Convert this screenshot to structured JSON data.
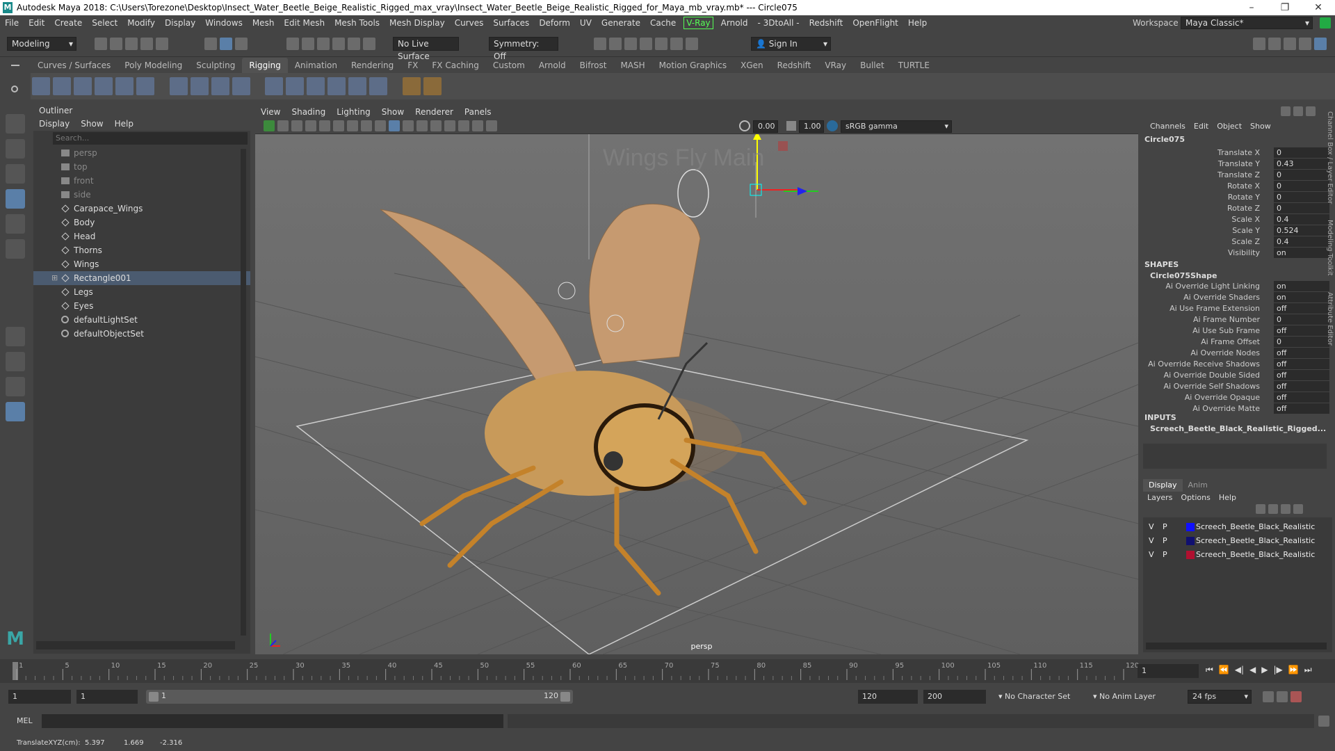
{
  "window": {
    "logo": "M",
    "title": "Autodesk Maya 2018: C:\\Users\\Torezone\\Desktop\\Insect_Water_Beetle_Beige_Realistic_Rigged_max_vray\\Insect_Water_Beetle_Beige_Realistic_Rigged_for_Maya_mb_vray.mb*  ---  Circle075",
    "controls": [
      "–",
      "❐",
      "✕"
    ]
  },
  "menubar": [
    "File",
    "Edit",
    "Create",
    "Select",
    "Modify",
    "Display",
    "Windows",
    "Mesh",
    "Edit Mesh",
    "Mesh Tools",
    "Mesh Display",
    "Curves",
    "Surfaces",
    "Deform",
    "UV",
    "Generate",
    "Cache",
    "V-Ray",
    "Arnold",
    "- 3DtoAll -",
    "Redshift",
    "OpenFlight",
    "Help"
  ],
  "workspace": {
    "label": "Workspace :",
    "value": "Maya Classic*"
  },
  "statusline": {
    "mode": "Modeling",
    "live_surface": "No Live Surface",
    "symmetry": "Symmetry: Off",
    "sign_in": "Sign In"
  },
  "shelf_tabs": [
    "Curves / Surfaces",
    "Poly Modeling",
    "Sculpting",
    "Rigging",
    "Animation",
    "Rendering",
    "FX",
    "FX Caching",
    "Custom",
    "Arnold",
    "Bifrost",
    "MASH",
    "Motion Graphics",
    "XGen",
    "Redshift",
    "VRay",
    "Bullet",
    "TURTLE"
  ],
  "shelf_active": "Rigging",
  "outliner": {
    "title": "Outliner",
    "menu": [
      "Display",
      "Show",
      "Help"
    ],
    "search_placeholder": "Search...",
    "items": [
      {
        "label": "persp",
        "kind": "camera"
      },
      {
        "label": "top",
        "kind": "camera"
      },
      {
        "label": "front",
        "kind": "camera"
      },
      {
        "label": "side",
        "kind": "camera"
      },
      {
        "label": "Carapace_Wings",
        "kind": "mesh"
      },
      {
        "label": "Body",
        "kind": "mesh"
      },
      {
        "label": "Head",
        "kind": "mesh"
      },
      {
        "label": "Thorns",
        "kind": "mesh"
      },
      {
        "label": "Wings",
        "kind": "mesh"
      },
      {
        "label": "Rectangle001",
        "kind": "mesh",
        "selected": true,
        "expandable": true
      },
      {
        "label": "Legs",
        "kind": "mesh"
      },
      {
        "label": "Eyes",
        "kind": "mesh"
      },
      {
        "label": "defaultLightSet",
        "kind": "set"
      },
      {
        "label": "defaultObjectSet",
        "kind": "set"
      }
    ]
  },
  "viewport": {
    "menu": [
      "View",
      "Shading",
      "Lighting",
      "Show",
      "Renderer",
      "Panels"
    ],
    "exposure": "0.00",
    "gamma": "1.00",
    "color_space": "sRGB gamma",
    "camera_label": "persp",
    "scene_text": "Wings  Fly  Main"
  },
  "channelbox": {
    "menu": [
      "Channels",
      "Edit",
      "Object",
      "Show"
    ],
    "object": "Circle075",
    "attrs": [
      {
        "k": "Translate X",
        "v": "0"
      },
      {
        "k": "Translate Y",
        "v": "0.43"
      },
      {
        "k": "Translate Z",
        "v": "0"
      },
      {
        "k": "Rotate X",
        "v": "0"
      },
      {
        "k": "Rotate Y",
        "v": "0"
      },
      {
        "k": "Rotate Z",
        "v": "0"
      },
      {
        "k": "Scale X",
        "v": "0.4"
      },
      {
        "k": "Scale Y",
        "v": "0.524"
      },
      {
        "k": "Scale Z",
        "v": "0.4"
      },
      {
        "k": "Visibility",
        "v": "on"
      }
    ],
    "shapes_header": "SHAPES",
    "shape_name": "Circle075Shape",
    "shape_attrs": [
      {
        "k": "Ai Override Light Linking",
        "v": "on"
      },
      {
        "k": "Ai Override Shaders",
        "v": "on"
      },
      {
        "k": "Ai Use Frame Extension",
        "v": "off"
      },
      {
        "k": "Ai Frame Number",
        "v": "0"
      },
      {
        "k": "Ai Use Sub Frame",
        "v": "off"
      },
      {
        "k": "Ai Frame Offset",
        "v": "0"
      },
      {
        "k": "Ai Override Nodes",
        "v": "off"
      },
      {
        "k": "Ai Override Receive Shadows",
        "v": "off"
      },
      {
        "k": "Ai Override Double Sided",
        "v": "off"
      },
      {
        "k": "Ai Override Self Shadows",
        "v": "off"
      },
      {
        "k": "Ai Override Opaque",
        "v": "off"
      },
      {
        "k": "Ai Override Matte",
        "v": "off"
      }
    ],
    "inputs_header": "INPUTS",
    "input_name": "Screech_Beetle_Black_Realistic_Rigged...",
    "side_tabs": [
      "Channel Box / Layer Editor",
      "Modeling Toolkit",
      "Attribute Editor"
    ]
  },
  "layers": {
    "tabs": [
      "Display",
      "Anim"
    ],
    "menu": [
      "Layers",
      "Options",
      "Help"
    ],
    "rows": [
      {
        "v": "V",
        "p": "P",
        "color": "#1010ff",
        "name": "Screech_Beetle_Black_Realistic"
      },
      {
        "v": "V",
        "p": "P",
        "color": "#101070",
        "name": "Screech_Beetle_Black_Realistic"
      },
      {
        "v": "V",
        "p": "P",
        "color": "#b01030",
        "name": "Screech_Beetle_Black_Realistic"
      }
    ]
  },
  "timeline": {
    "ticks": [
      "1",
      "5",
      "10",
      "15",
      "20",
      "25",
      "30",
      "35",
      "40",
      "45",
      "50",
      "55",
      "60",
      "65",
      "70",
      "75",
      "80",
      "85",
      "90",
      "95",
      "100",
      "105",
      "110",
      "115",
      "120"
    ],
    "current_frame": "1"
  },
  "range": {
    "start": "1",
    "playback_start": "1",
    "slider_start": "1",
    "slider_end": "120",
    "playback_end": "120",
    "end": "200",
    "character_set": "No Character Set",
    "anim_layer": "No Anim Layer",
    "fps": "24 fps"
  },
  "cmdline": {
    "label": "MEL"
  },
  "helpline": {
    "label": "TranslateXYZ(cm):",
    "x": "5.397",
    "y": "1.669",
    "z": "-2.316"
  }
}
